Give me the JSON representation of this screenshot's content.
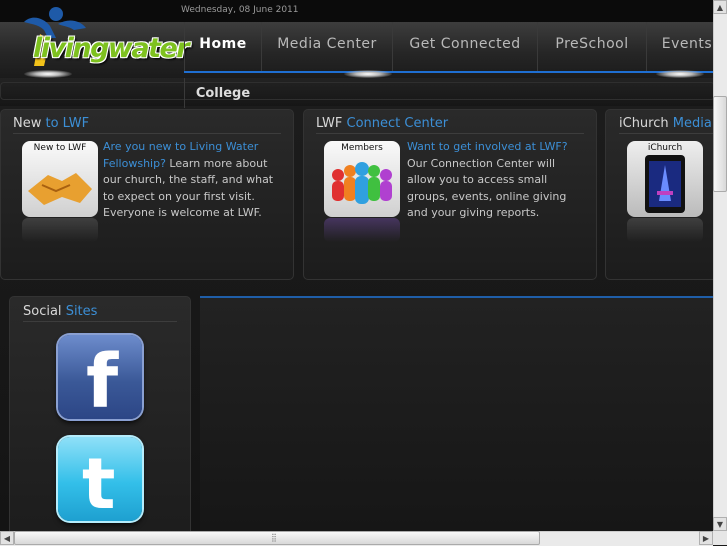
{
  "top_bar": {
    "date": "Wednesday, 08 June 2011"
  },
  "logo": {
    "text": "livingwater"
  },
  "nav": {
    "items": [
      "Home",
      "Media Center",
      "Get Connected",
      "PreSchool",
      "Events",
      "College"
    ],
    "active": "Home"
  },
  "panels": [
    {
      "title_plain": "New ",
      "title_highlight": "to LWF",
      "icon_caption": "New to LWF",
      "link": "Are you new to Living Water Fellowship?",
      "text": "Learn more about our church, the staff, and what to expect on your first visit.  Everyone is welcome at LWF."
    },
    {
      "title_plain": "LWF ",
      "title_highlight": "Connect Center",
      "icon_caption": "Members",
      "link": "Want to get involved at LWF?",
      "text": "Our Connection Center will allow you to access small groups, events, online giving and your giving reports."
    },
    {
      "title_plain": "iChurch ",
      "title_highlight": "Media",
      "icon_caption": "iChurch"
    }
  ],
  "social": {
    "title_plain": "Social ",
    "title_highlight": "Sites",
    "facebook_glyph": "f",
    "twitter_glyph": "t"
  },
  "colors": {
    "accent": "#3c8fd6",
    "nav_line": "#1f6fd2",
    "logo_green": "#7ec11f",
    "facebook": "#3b5998",
    "twitter": "#33bfe9"
  },
  "scrollbars": {
    "up": "▲",
    "down": "▼",
    "left": "◀",
    "right": "▶",
    "grip": "⣿"
  }
}
